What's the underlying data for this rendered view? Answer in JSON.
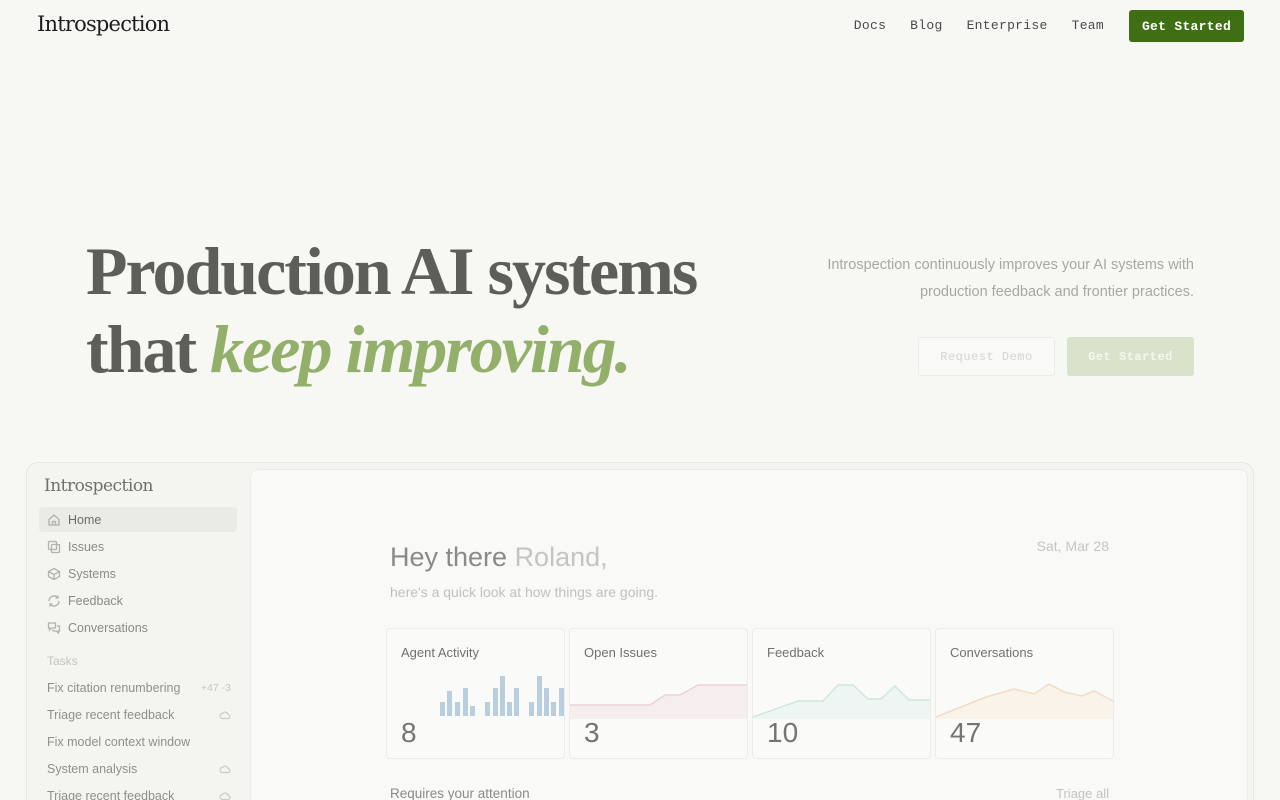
{
  "nav": {
    "logo": "Introspection",
    "links": [
      "Docs",
      "Blog",
      "Enterprise",
      "Team"
    ],
    "cta": "Get Started"
  },
  "hero": {
    "title_line1": "Production AI systems",
    "title_line2_plain": "that ",
    "title_line2_accent": "keep improving.",
    "subtitle": "Introspection continuously improves your AI systems with production feedback and frontier practices.",
    "secondary_button": "Request Demo",
    "primary_button": "Get Started"
  },
  "app": {
    "logo": "Introspection",
    "sidebar": [
      {
        "label": "Home",
        "icon": "home-icon"
      },
      {
        "label": "Issues",
        "icon": "issues-icon"
      },
      {
        "label": "Systems",
        "icon": "cube-icon"
      },
      {
        "label": "Feedback",
        "icon": "refresh-icon"
      },
      {
        "label": "Conversations",
        "icon": "chat-icon"
      }
    ],
    "tasks_label": "Tasks",
    "tasks": [
      {
        "label": "Fix citation renumbering",
        "meta": "+47 -3"
      },
      {
        "label": "Triage recent feedback",
        "meta": ""
      },
      {
        "label": "Fix model context window",
        "meta": ""
      },
      {
        "label": "System analysis",
        "meta": ""
      },
      {
        "label": "Triage recent feedback",
        "meta": ""
      }
    ],
    "greeting": "Hey there ",
    "user_name": "Roland,",
    "greeting_sub": "here's a quick look at how things are going.",
    "date": "Sat, Mar 28",
    "cards": [
      {
        "title": "Agent Activity",
        "value": "8",
        "color": "#b8cfe0"
      },
      {
        "title": "Open Issues",
        "value": "3",
        "color": "#ecd5d5"
      },
      {
        "title": "Feedback",
        "value": "10",
        "color": "#cfe7e1"
      },
      {
        "title": "Conversations",
        "value": "47",
        "color": "#f2dcc4"
      }
    ],
    "attention_label": "Requires your attention",
    "triage_all": "Triage all"
  }
}
